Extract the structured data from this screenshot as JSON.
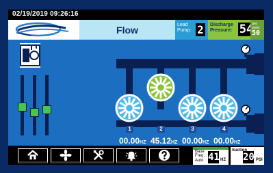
{
  "topbar": {
    "datetime": "02/19/2019 09:26:16"
  },
  "header": {
    "mode_label": "Flow",
    "lead_pump": {
      "label_line1": "Lead",
      "label_line2": "Pump:",
      "value": "2"
    },
    "discharge": {
      "label_line1": "Discharge",
      "label_line2": "Pressure:",
      "value": "54"
    },
    "setpoint": {
      "label_line1": "Set",
      "label_line2": "point:",
      "value": "50"
    }
  },
  "pumps": [
    {
      "number": "1",
      "speed": "00.00",
      "unit": "HZ",
      "state": "idle"
    },
    {
      "number": "2",
      "speed": "45.12",
      "unit": "HZ",
      "state": "running"
    },
    {
      "number": "3",
      "speed": "00.00",
      "unit": "HZ",
      "state": "idle"
    },
    {
      "number": "4",
      "speed": "00.00",
      "unit": "HZ",
      "state": "idle"
    }
  ],
  "bottom": {
    "nav": [
      {
        "name": "home-button",
        "icon": "home-icon"
      },
      {
        "name": "pumps-button",
        "icon": "fan-icon"
      },
      {
        "name": "settings-button",
        "icon": "tools-icon"
      },
      {
        "name": "alarms-button",
        "icon": "bell-icon"
      },
      {
        "name": "help-button",
        "icon": "question-icon"
      }
    ],
    "base_freq": {
      "label_line1": "Base",
      "label_line2": "Freq.",
      "label_line3": "Auto",
      "value": "41",
      "unit": "HZ"
    },
    "suction": {
      "label": "Suction",
      "value": "20",
      "unit": "PSI"
    }
  },
  "colors": {
    "running": "#8ac43e",
    "idle": "#4cb8ec",
    "panel": "#1c6ec0",
    "background": "#0a2a63"
  }
}
